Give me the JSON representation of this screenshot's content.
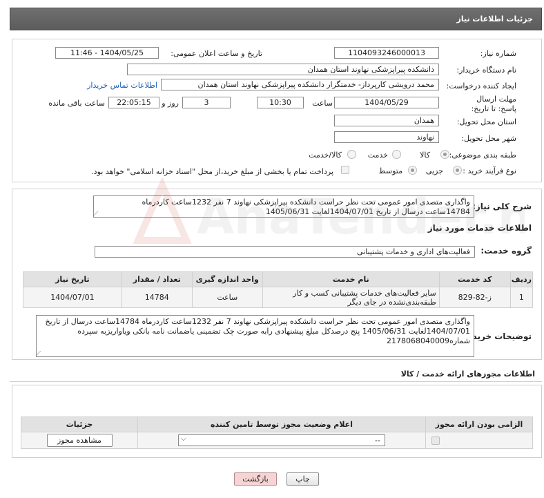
{
  "header": {
    "title": "جزئیات اطلاعات نیاز"
  },
  "form": {
    "need_number_label": "شماره نیاز:",
    "need_number": "1104093246000013",
    "announce_label": "تاریخ و ساعت اعلان عمومی:",
    "announce_value": "1404/05/25 - 11:46",
    "buyer_org_label": "نام دستگاه خریدار:",
    "buyer_org": "دانشکده پیراپزشکی نهاوند  استان همدان",
    "creator_label": "ایجاد کننده درخواست:",
    "creator": "محمد درویشی کارپرداز- خدمتگزار دانشکده پیراپزشکی نهاوند  استان همدان",
    "contact_link": "اطلاعات تماس خریدار",
    "deadline_label": "مهلت ارسال پاسخ: تا تاریخ:",
    "deadline_date": "1404/05/29",
    "time_label": "ساعت",
    "deadline_time": "10:30",
    "days_value": "3",
    "days_label": "روز و",
    "remaining_time": "22:05:15",
    "remaining_label": "ساعت باقی مانده",
    "province_label": "استان محل تحویل:",
    "province": "همدان",
    "city_label": "شهر محل تحویل:",
    "city": "نهاوند",
    "category_label": "طبقه بندی موضوعی:",
    "category_options": [
      "کالا",
      "خدمت",
      "کالا/خدمت"
    ],
    "process_label": "نوع فرآیند خرید :",
    "process_options": [
      "جزیی",
      "متوسط"
    ],
    "payment_note": "پرداخت تمام یا بخشی از مبلغ خرید،از محل \"اسناد خزانه اسلامی\" خواهد بود."
  },
  "summary": {
    "label": "شرح کلی نیاز:",
    "text": "واگذاری متصدی امور عمومی تحت نظر حراست دانشکده پیراپزشکی نهاوند 7 نفر 1232ساعت کاردرماه 14784ساعت درسال از تاریخ 1404/07/01لغایت 1405/06/31"
  },
  "services": {
    "title": "اطلاعات خدمات مورد نیاز",
    "group_label": "گروه خدمت:",
    "group_value": "فعالیت‌های اداری و خدمات پشتیبانی",
    "columns": [
      "ردیف",
      "کد خدمت",
      "نام خدمت",
      "واحد اندازه گیری",
      "تعداد / مقدار",
      "تاریخ نیاز"
    ],
    "rows": [
      [
        "1",
        "ز-82-829",
        "سایر فعالیت‌های خدمات پشتیبانی کسب و کار طبقه‌بندی‌نشده در جای دیگر",
        "ساعت",
        "14784",
        "1404/07/01"
      ]
    ]
  },
  "buyer_notes": {
    "label": "توضیحات خریدار:",
    "text": "واگذاری متصدی امور عمومی تحت نظر حراست دانشکده پیراپزشکی نهاوند 7 نفر 1232ساعت کاردرماه 14784ساعت درسال از تاریخ 1404/07/01لغایت 1405/06/31 پنج درصدکل مبلغ پیشنهادی رابه صورت چک تضمینی یاضمانت نامه بانکی ویاواریزبه سپرده شماره2178068040009"
  },
  "permits": {
    "title": "اطلاعات مجوزهای ارائه خدمت / کالا",
    "columns": [
      "الزامی بودن ارائه مجوز",
      "اعلام وضعیت مجوز توسط تامین کننده",
      "جزئیات"
    ],
    "select_value": "--",
    "view_button": "مشاهده مجوز"
  },
  "footer": {
    "print_label": "چاپ",
    "back_label": "بازگشت"
  },
  "watermark": {
    "text": "AnaTender.net"
  },
  "colors": {
    "header_bg": "#666666",
    "link": "#1a5fb4",
    "back_button_bg": "#f6d4d4"
  }
}
